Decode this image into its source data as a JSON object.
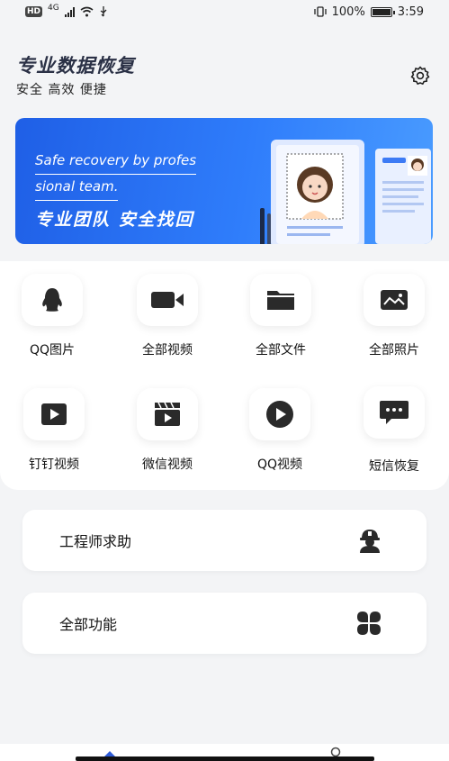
{
  "status_bar": {
    "hd": "HD",
    "network": "4G",
    "battery_text": "100%",
    "battery_level": 1.0,
    "time": "3:59"
  },
  "header": {
    "title": "专业数据恢复",
    "subtitle": "安全 高效 便捷",
    "settings_icon": "gear-icon"
  },
  "banner": {
    "line1": "Safe recovery by profes",
    "line2": "sional team.",
    "slogan": "专业团队 安全找回",
    "accent": "#2f7dfb"
  },
  "features": [
    {
      "label": "QQ图片",
      "icon": "penguin-icon"
    },
    {
      "label": "全部视频",
      "icon": "video-camera-icon"
    },
    {
      "label": "全部文件",
      "icon": "folder-icon"
    },
    {
      "label": "全部照片",
      "icon": "image-icon"
    },
    {
      "label": "钉钉视频",
      "icon": "play-box-icon"
    },
    {
      "label": "微信视频",
      "icon": "clapperboard-icon"
    },
    {
      "label": "QQ视频",
      "icon": "play-circle-icon"
    },
    {
      "label": "短信恢复",
      "icon": "message-icon"
    }
  ],
  "cards": {
    "engineer": {
      "label": "工程师求助",
      "icon": "engineer-icon"
    },
    "all_functions": {
      "label": "全部功能",
      "icon": "four-petal-icon"
    }
  }
}
